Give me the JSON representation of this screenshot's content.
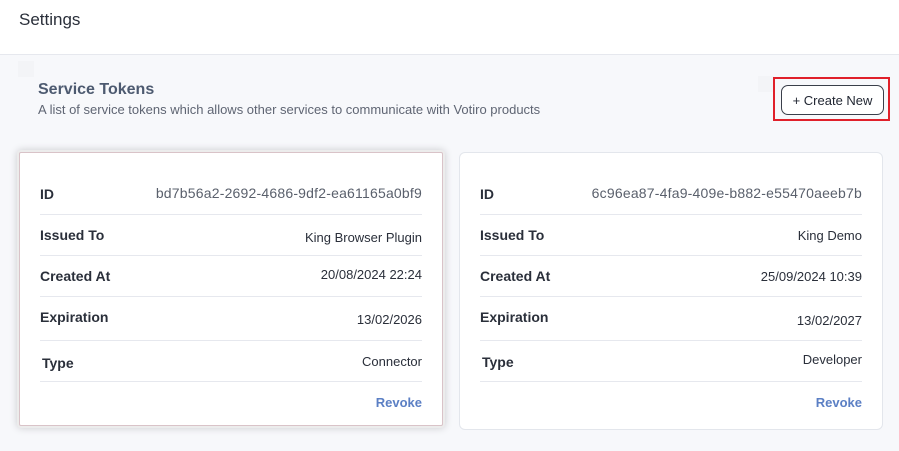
{
  "header": {
    "title": "Settings"
  },
  "section": {
    "title": "Service Tokens",
    "description": "A list of service tokens which allows other services to communicate with Votiro products",
    "create_label": "+ Create New"
  },
  "tokens": [
    {
      "id_label": "ID",
      "id": "bd7b56a2-2692-4686-9df2-ea61165a0bf9",
      "issued_to_label": "Issued To",
      "issued_to": "King Browser Plugin",
      "created_at_label": "Created At",
      "created_at": "20/08/2024 22:24",
      "expiration_label": "Expiration",
      "expiration": "13/02/2026",
      "type_label": "Type",
      "type": "Connector",
      "revoke_label": "Revoke"
    },
    {
      "id_label": "ID",
      "id": "6c96ea87-4fa9-409e-b882-e55470aeeb7b",
      "issued_to_label": "Issued To",
      "issued_to": "King Demo",
      "created_at_label": "Created At",
      "created_at": "25/09/2024 10:39",
      "expiration_label": "Expiration",
      "expiration": "13/02/2027",
      "type_label": "Type",
      "type": "Developer",
      "revoke_label": "Revoke"
    }
  ],
  "colors": {
    "accent_link": "#5b7fc4",
    "highlight_border": "#e0202a",
    "section_title": "#4d5a70"
  }
}
